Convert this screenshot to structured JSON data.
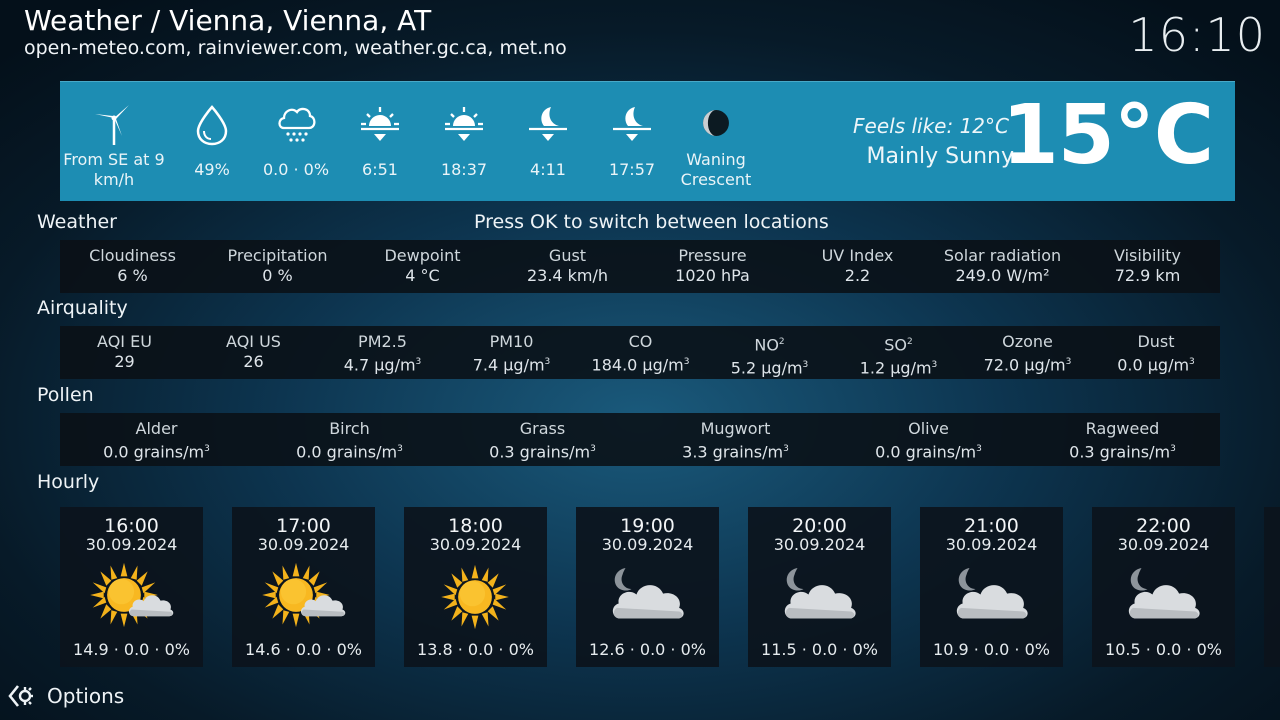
{
  "header": {
    "title": "Weather / Vienna, Vienna, AT",
    "sources": "open-meteo.com, rainviewer.com, weather.gc.ca, met.no",
    "time": "16:10"
  },
  "current": {
    "items": [
      {
        "icon": "wind-turbine-icon",
        "value": "From SE at 9 km/h"
      },
      {
        "icon": "humidity-drop-icon",
        "value": "49%"
      },
      {
        "icon": "precipitation-cloud-icon",
        "value": "0.0 · 0%"
      },
      {
        "icon": "sunrise-icon",
        "value": "6:51"
      },
      {
        "icon": "sunset-icon",
        "value": "18:37"
      },
      {
        "icon": "moonrise-icon",
        "value": "4:11"
      },
      {
        "icon": "moonset-icon",
        "value": "17:57"
      },
      {
        "icon": "moon-phase-icon",
        "value": "Waning Crescent"
      }
    ],
    "feels_like": "Feels like: 12°C",
    "condition": "Mainly Sunny",
    "temperature": "15°C"
  },
  "switch_hint": "Press OK to switch between locations",
  "weather": {
    "label": "Weather",
    "items": [
      {
        "label": "Cloudiness",
        "value": "6 %"
      },
      {
        "label": "Precipitation",
        "value": "0 %"
      },
      {
        "label": "Dewpoint",
        "value": "4 °C"
      },
      {
        "label": "Gust",
        "value": "23.4 km/h"
      },
      {
        "label": "Pressure",
        "value": "1020 hPa"
      },
      {
        "label": "UV Index",
        "value": "2.2"
      },
      {
        "label": "Solar radiation",
        "value": "249.0 W/m²"
      },
      {
        "label": "Visibility",
        "value": "72.9 km"
      }
    ]
  },
  "airquality": {
    "label": "Airquality",
    "items": [
      {
        "label": "AQI EU",
        "sup": "",
        "value": "29",
        "unit": ""
      },
      {
        "label": "AQI US",
        "sup": "",
        "value": "26",
        "unit": ""
      },
      {
        "label": "PM2.5",
        "sup": "",
        "value": "4.7 µg/m",
        "unit": "3"
      },
      {
        "label": "PM10",
        "sup": "",
        "value": "7.4 µg/m",
        "unit": "3"
      },
      {
        "label": "CO",
        "sup": "",
        "value": "184.0 µg/m",
        "unit": "3"
      },
      {
        "label": "NO",
        "sup": "2",
        "value": "5.2 µg/m",
        "unit": "3"
      },
      {
        "label": "SO",
        "sup": "2",
        "value": "1.2 µg/m",
        "unit": "3"
      },
      {
        "label": "Ozone",
        "sup": "",
        "value": "72.0 µg/m",
        "unit": "3"
      },
      {
        "label": "Dust",
        "sup": "",
        "value": "0.0 µg/m",
        "unit": "3"
      }
    ]
  },
  "pollen": {
    "label": "Pollen",
    "items": [
      {
        "label": "Alder",
        "value": "0.0 grains/m",
        "unit": "3"
      },
      {
        "label": "Birch",
        "value": "0.0 grains/m",
        "unit": "3"
      },
      {
        "label": "Grass",
        "value": "0.3 grains/m",
        "unit": "3"
      },
      {
        "label": "Mugwort",
        "value": "3.3 grains/m",
        "unit": "3"
      },
      {
        "label": "Olive",
        "value": "0.0 grains/m",
        "unit": "3"
      },
      {
        "label": "Ragweed",
        "value": "0.3 grains/m",
        "unit": "3"
      }
    ]
  },
  "hourly": {
    "label": "Hourly",
    "items": [
      {
        "time": "16:00",
        "date": "30.09.2024",
        "icon": "sun-cloud-icon",
        "summary": "14.9 · 0.0 · 0%"
      },
      {
        "time": "17:00",
        "date": "30.09.2024",
        "icon": "sun-cloud-icon",
        "summary": "14.6 · 0.0 · 0%"
      },
      {
        "time": "18:00",
        "date": "30.09.2024",
        "icon": "sun-icon",
        "summary": "13.8 · 0.0 · 0%"
      },
      {
        "time": "19:00",
        "date": "30.09.2024",
        "icon": "moon-cloud-icon",
        "summary": "12.6 · 0.0 · 0%"
      },
      {
        "time": "20:00",
        "date": "30.09.2024",
        "icon": "moon-cloud-icon",
        "summary": "11.5 · 0.0 · 0%"
      },
      {
        "time": "21:00",
        "date": "30.09.2024",
        "icon": "moon-cloud-icon",
        "summary": "10.9 · 0.0 · 0%"
      },
      {
        "time": "22:00",
        "date": "30.09.2024",
        "icon": "moon-cloud-icon",
        "summary": "10.5 · 0.0 · 0%"
      }
    ]
  },
  "options": {
    "label": "Options",
    "icon": "options-icon"
  }
}
